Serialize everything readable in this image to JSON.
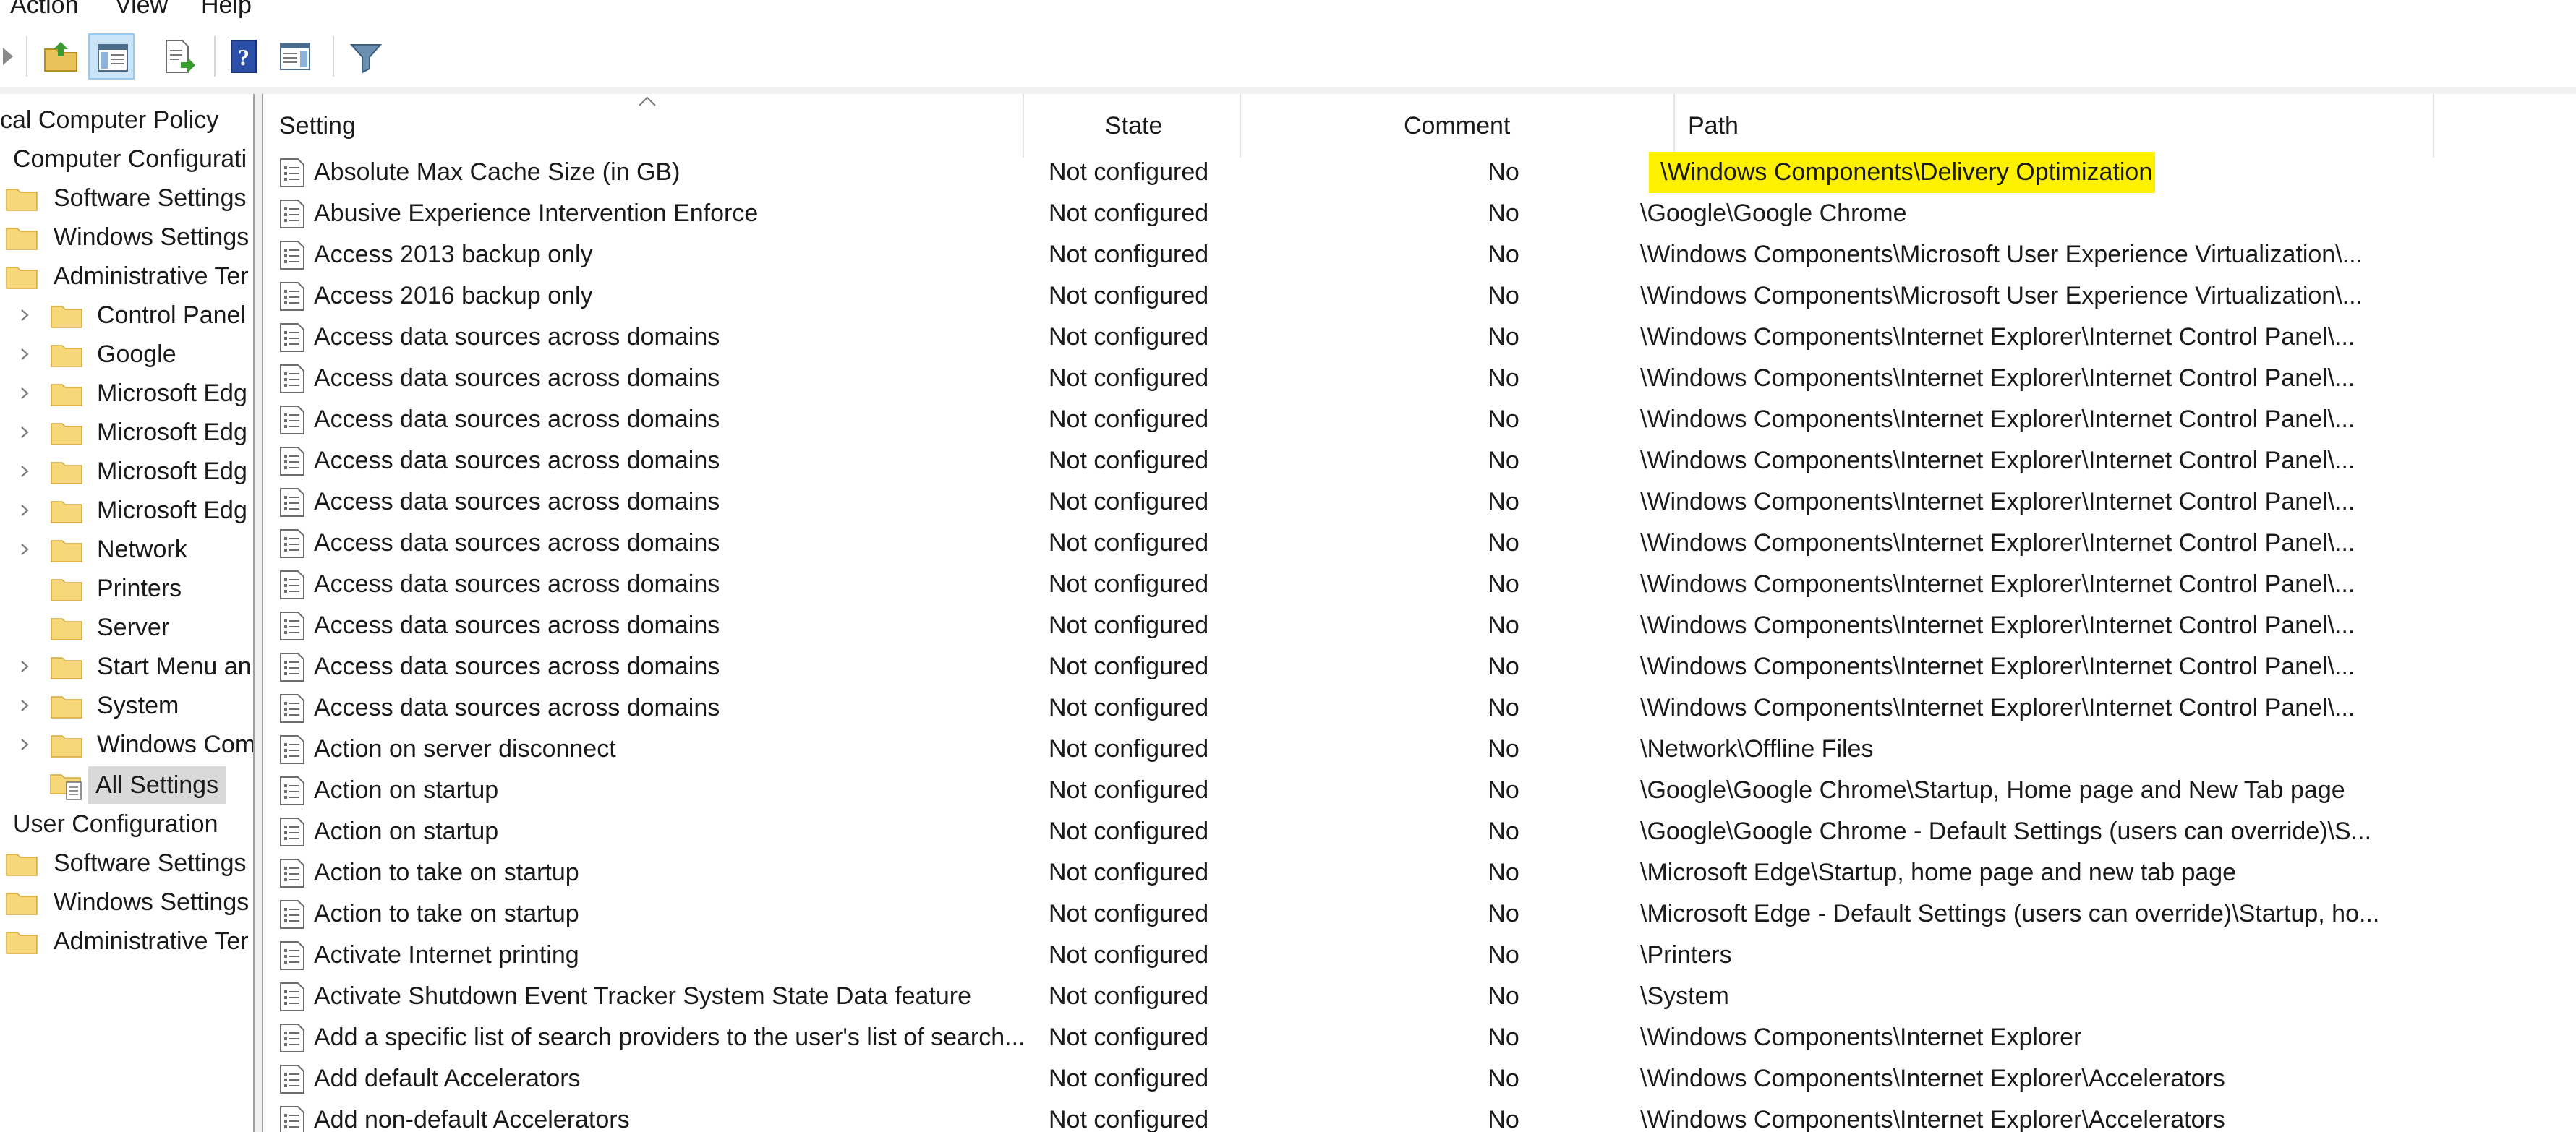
{
  "menu": {
    "action": "Action",
    "view": "View",
    "help": "Help"
  },
  "toolbar": {
    "buttons": [
      {
        "icon": "back-arrow-icon"
      },
      {
        "icon": "up-folder-icon"
      },
      {
        "icon": "show-hide-tree-icon",
        "active": true
      },
      {
        "icon": "export-list-icon"
      },
      {
        "icon": "help-icon"
      },
      {
        "icon": "show-action-pane-icon"
      },
      {
        "icon": "filter-icon"
      }
    ]
  },
  "tree": {
    "root": "cal Computer Policy",
    "computer_config": "Computer Configurati",
    "software_settings": "Software Settings",
    "windows_settings": "Windows Settings",
    "admin_templates": "Administrative Ter",
    "items": [
      {
        "label": "Control Panel",
        "expandable": true
      },
      {
        "label": "Google",
        "expandable": true
      },
      {
        "label": "Microsoft Edg",
        "expandable": true
      },
      {
        "label": "Microsoft Edg",
        "expandable": true
      },
      {
        "label": "Microsoft Edg",
        "expandable": true
      },
      {
        "label": "Microsoft Edg",
        "expandable": true
      },
      {
        "label": "Network",
        "expandable": true
      },
      {
        "label": "Printers",
        "expandable": false
      },
      {
        "label": "Server",
        "expandable": false
      },
      {
        "label": "Start Menu an",
        "expandable": true
      },
      {
        "label": "System",
        "expandable": true
      },
      {
        "label": "Windows Com",
        "expandable": true
      }
    ],
    "all_settings": "All Settings",
    "user_config": "User Configuration",
    "user_software_settings": "Software Settings",
    "user_windows_settings": "Windows Settings",
    "user_admin_templates": "Administrative Ter"
  },
  "table": {
    "columns": {
      "setting": "Setting",
      "state": "State",
      "comment": "Comment",
      "path": "Path"
    },
    "rows": [
      {
        "setting": "Absolute Max Cache Size (in GB)",
        "state": "Not configured",
        "comment": "No",
        "path": "\\Windows Components\\Delivery Optimization",
        "highlight": true
      },
      {
        "setting": "Abusive Experience Intervention Enforce",
        "state": "Not configured",
        "comment": "No",
        "path": "\\Google\\Google Chrome"
      },
      {
        "setting": "Access 2013 backup only",
        "state": "Not configured",
        "comment": "No",
        "path": "\\Windows Components\\Microsoft User Experience Virtualization\\..."
      },
      {
        "setting": "Access 2016 backup only",
        "state": "Not configured",
        "comment": "No",
        "path": "\\Windows Components\\Microsoft User Experience Virtualization\\..."
      },
      {
        "setting": "Access data sources across domains",
        "state": "Not configured",
        "comment": "No",
        "path": "\\Windows Components\\Internet Explorer\\Internet Control Panel\\..."
      },
      {
        "setting": "Access data sources across domains",
        "state": "Not configured",
        "comment": "No",
        "path": "\\Windows Components\\Internet Explorer\\Internet Control Panel\\..."
      },
      {
        "setting": "Access data sources across domains",
        "state": "Not configured",
        "comment": "No",
        "path": "\\Windows Components\\Internet Explorer\\Internet Control Panel\\..."
      },
      {
        "setting": "Access data sources across domains",
        "state": "Not configured",
        "comment": "No",
        "path": "\\Windows Components\\Internet Explorer\\Internet Control Panel\\..."
      },
      {
        "setting": "Access data sources across domains",
        "state": "Not configured",
        "comment": "No",
        "path": "\\Windows Components\\Internet Explorer\\Internet Control Panel\\..."
      },
      {
        "setting": "Access data sources across domains",
        "state": "Not configured",
        "comment": "No",
        "path": "\\Windows Components\\Internet Explorer\\Internet Control Panel\\..."
      },
      {
        "setting": "Access data sources across domains",
        "state": "Not configured",
        "comment": "No",
        "path": "\\Windows Components\\Internet Explorer\\Internet Control Panel\\..."
      },
      {
        "setting": "Access data sources across domains",
        "state": "Not configured",
        "comment": "No",
        "path": "\\Windows Components\\Internet Explorer\\Internet Control Panel\\..."
      },
      {
        "setting": "Access data sources across domains",
        "state": "Not configured",
        "comment": "No",
        "path": "\\Windows Components\\Internet Explorer\\Internet Control Panel\\..."
      },
      {
        "setting": "Access data sources across domains",
        "state": "Not configured",
        "comment": "No",
        "path": "\\Windows Components\\Internet Explorer\\Internet Control Panel\\..."
      },
      {
        "setting": "Action on server disconnect",
        "state": "Not configured",
        "comment": "No",
        "path": "\\Network\\Offline Files"
      },
      {
        "setting": "Action on startup",
        "state": "Not configured",
        "comment": "No",
        "path": "\\Google\\Google Chrome\\Startup, Home page and New Tab page"
      },
      {
        "setting": "Action on startup",
        "state": "Not configured",
        "comment": "No",
        "path": "\\Google\\Google Chrome - Default Settings (users can override)\\S..."
      },
      {
        "setting": "Action to take on startup",
        "state": "Not configured",
        "comment": "No",
        "path": "\\Microsoft Edge\\Startup, home page and new tab page"
      },
      {
        "setting": "Action to take on startup",
        "state": "Not configured",
        "comment": "No",
        "path": "\\Microsoft Edge - Default Settings (users can override)\\Startup, ho..."
      },
      {
        "setting": "Activate Internet printing",
        "state": "Not configured",
        "comment": "No",
        "path": "\\Printers"
      },
      {
        "setting": "Activate Shutdown Event Tracker System State Data feature",
        "state": "Not configured",
        "comment": "No",
        "path": "\\System"
      },
      {
        "setting": "Add a specific list of search providers to the user's list of search...",
        "state": "Not configured",
        "comment": "No",
        "path": "\\Windows Components\\Internet Explorer"
      },
      {
        "setting": "Add default Accelerators",
        "state": "Not configured",
        "comment": "No",
        "path": "\\Windows Components\\Internet Explorer\\Accelerators"
      },
      {
        "setting": "Add non-default Accelerators",
        "state": "Not configured",
        "comment": "No",
        "path": "\\Windows Components\\Internet Explorer\\Accelerators"
      }
    ]
  },
  "colors": {
    "highlight": "#fff200",
    "selection": "#d9d9d9",
    "active_button": "#cce4f7",
    "folder": "#f6d77a"
  }
}
